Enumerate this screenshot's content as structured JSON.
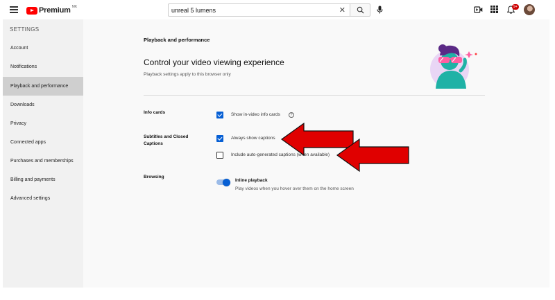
{
  "header": {
    "logo_text": "Premium",
    "logo_region": "MK",
    "search_value": "unreal 5 lumens",
    "notification_count": "9+"
  },
  "sidebar": {
    "heading": "SETTINGS",
    "items": [
      {
        "label": "Account"
      },
      {
        "label": "Notifications"
      },
      {
        "label": "Playback and performance",
        "active": true
      },
      {
        "label": "Downloads"
      },
      {
        "label": "Privacy"
      },
      {
        "label": "Connected apps"
      },
      {
        "label": "Purchases and memberships"
      },
      {
        "label": "Billing and payments"
      },
      {
        "label": "Advanced settings"
      }
    ]
  },
  "main": {
    "section_title": "Playback and performance",
    "title": "Control your video viewing experience",
    "subtitle": "Playback settings apply to this browser only",
    "info_cards": {
      "label": "Info cards",
      "option": "Show in-video info cards",
      "checked": true
    },
    "subtitles": {
      "label": "Subtitles and Closed Captions",
      "options": [
        {
          "label": "Always show captions",
          "checked": true
        },
        {
          "label": "Include auto-generated captions (when available)",
          "checked": false
        }
      ]
    },
    "browsing": {
      "label": "Browsing",
      "toggle_label": "Inline playback",
      "toggle_desc": "Play videos when you hover over them on the home screen",
      "enabled": true
    }
  },
  "colors": {
    "accent": "#065fd4",
    "brand_red": "#ff0000",
    "annotation_arrow": "#e00000"
  }
}
